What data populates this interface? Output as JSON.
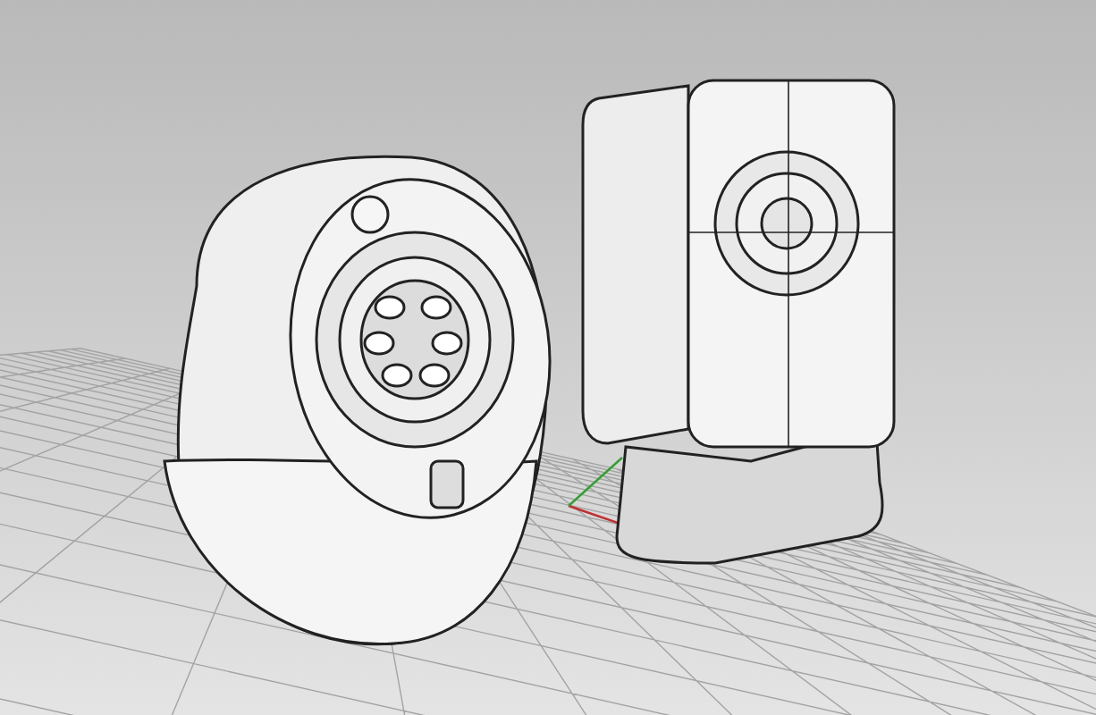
{
  "viewport": {
    "show_grid": true
  }
}
